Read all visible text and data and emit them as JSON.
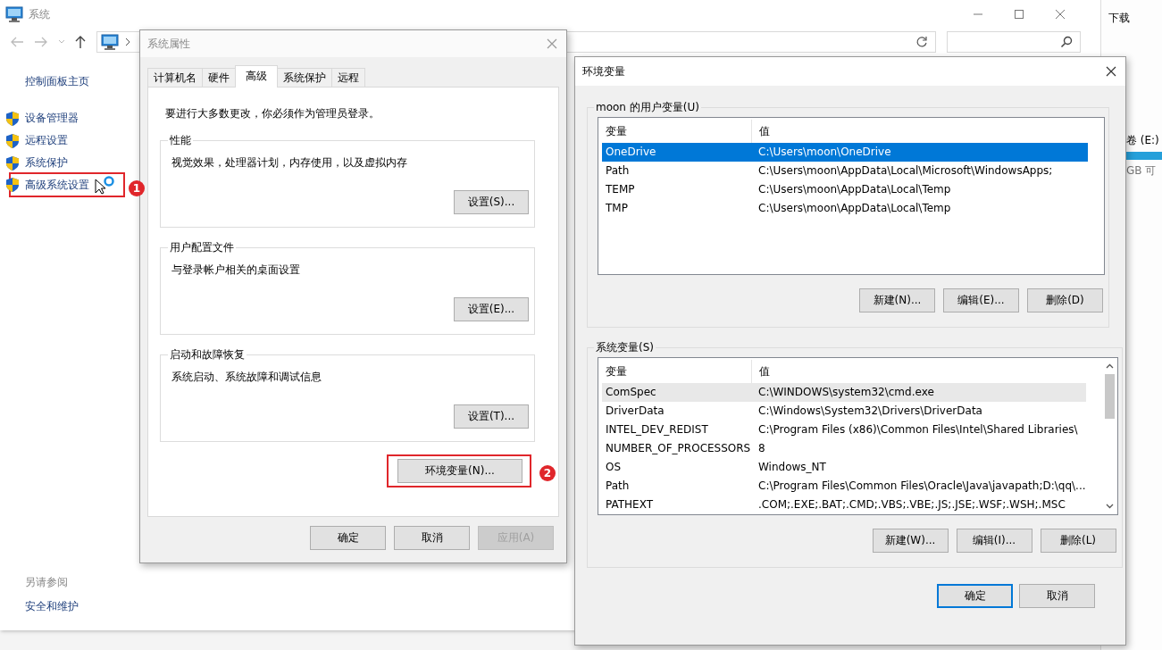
{
  "explorer": {
    "title": "系统",
    "sidebar": {
      "home": "控制面板主页",
      "items": [
        {
          "label": "设备管理器",
          "highlighted": false
        },
        {
          "label": "远程设置",
          "highlighted": false
        },
        {
          "label": "系统保护",
          "highlighted": false
        },
        {
          "label": "高级系统设置",
          "highlighted": true,
          "badge": "1"
        }
      ],
      "see_also": "另请参阅",
      "links": [
        "安全和维护"
      ]
    }
  },
  "background_window": {
    "title": "下载",
    "drive_label": "卷 (E:)",
    "drive_free": "GB 可"
  },
  "system_properties": {
    "title": "系统属性",
    "tabs": [
      {
        "label": "计算机名",
        "selected": false
      },
      {
        "label": "硬件",
        "selected": false
      },
      {
        "label": "高级",
        "selected": true
      },
      {
        "label": "系统保护",
        "selected": false
      },
      {
        "label": "远程",
        "selected": false
      }
    ],
    "notice": "要进行大多数更改，你必须作为管理员登录。",
    "groups": [
      {
        "label": "性能",
        "description": "视觉效果，处理器计划，内存使用，以及虚拟内存",
        "button": "设置(S)..."
      },
      {
        "label": "用户配置文件",
        "description": "与登录帐户相关的桌面设置",
        "button": "设置(E)..."
      },
      {
        "label": "启动和故障恢复",
        "description": "系统启动、系统故障和调试信息",
        "button": "设置(T)..."
      }
    ],
    "env_button": {
      "label": "环境变量(N)...",
      "highlighted": true,
      "badge": "2"
    },
    "buttons": [
      {
        "label": "确定",
        "disabled": false
      },
      {
        "label": "取消",
        "disabled": false
      },
      {
        "label": "应用(A)",
        "disabled": true
      }
    ]
  },
  "environment_variables": {
    "title": "环境变量",
    "user_vars": {
      "label": "moon 的用户变量(U)",
      "focused": true,
      "scrollbar": false,
      "columns": [
        "变量",
        "值"
      ],
      "rows": [
        {
          "name": "OneDrive",
          "value": "C:\\Users\\moon\\OneDrive",
          "selected": true
        },
        {
          "name": "Path",
          "value": "C:\\Users\\moon\\AppData\\Local\\Microsoft\\WindowsApps;",
          "selected": false
        },
        {
          "name": "TEMP",
          "value": "C:\\Users\\moon\\AppData\\Local\\Temp",
          "selected": false
        },
        {
          "name": "TMP",
          "value": "C:\\Users\\moon\\AppData\\Local\\Temp",
          "selected": false
        }
      ],
      "buttons": [
        "新建(N)...",
        "编辑(E)...",
        "删除(D)"
      ]
    },
    "system_vars": {
      "label": "系统变量(S)",
      "focused": false,
      "scrollbar": true,
      "columns": [
        "变量",
        "值"
      ],
      "rows": [
        {
          "name": "ComSpec",
          "value": "C:\\WINDOWS\\system32\\cmd.exe",
          "selected": true
        },
        {
          "name": "DriverData",
          "value": "C:\\Windows\\System32\\Drivers\\DriverData",
          "selected": false
        },
        {
          "name": "INTEL_DEV_REDIST",
          "value": "C:\\Program Files (x86)\\Common Files\\Intel\\Shared Libraries\\",
          "selected": false
        },
        {
          "name": "NUMBER_OF_PROCESSORS",
          "value": "8",
          "selected": false
        },
        {
          "name": "OS",
          "value": "Windows_NT",
          "selected": false
        },
        {
          "name": "Path",
          "value": "C:\\Program Files\\Common Files\\Oracle\\Java\\javapath;D:\\qq\\...",
          "selected": false
        },
        {
          "name": "PATHEXT",
          "value": ".COM;.EXE;.BAT;.CMD;.VBS;.VBE;.JS;.JSE;.WSF;.WSH;.MSC",
          "selected": false
        }
      ],
      "buttons": [
        "新建(W)...",
        "编辑(I)...",
        "删除(L)"
      ]
    },
    "buttons": [
      {
        "label": "确定",
        "default": true
      },
      {
        "label": "取消",
        "default": false
      }
    ]
  }
}
